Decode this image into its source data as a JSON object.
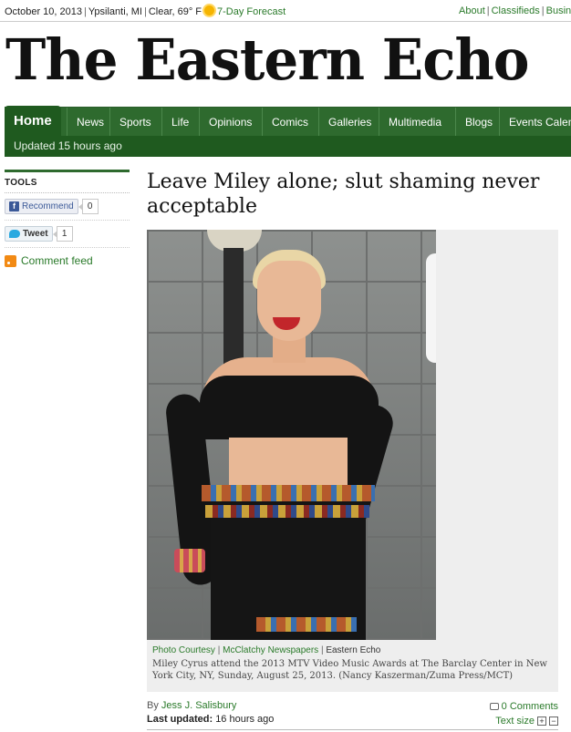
{
  "topbar": {
    "date": "October 10, 2013",
    "location": "Ypsilanti, MI",
    "weather": "Clear, 69° F",
    "forecast_link": "7-Day Forecast",
    "right_links": [
      "About",
      "Classifieds",
      "Busin"
    ]
  },
  "masthead": {
    "title": "The Eastern Echo"
  },
  "nav": {
    "items": [
      "Home",
      "News",
      "Sports",
      "Life",
      "Opinions",
      "Comics",
      "Galleries",
      "Multimedia",
      "Blogs",
      "Events Calen"
    ],
    "updated": "Updated 15 hours ago"
  },
  "tools": {
    "title": "TOOLS",
    "recommend_label": "Recommend",
    "recommend_count": "0",
    "tweet_label": "Tweet",
    "tweet_count": "1",
    "comment_feed": "Comment feed"
  },
  "article": {
    "headline": "Leave Miley alone; slut shaming never acceptable",
    "photo_credit_label": "Photo Courtesy",
    "photo_credit_source": "McClatchy Newspapers",
    "photo_credit_outlet": "Eastern Echo",
    "caption": "Miley Cyrus attend the 2013 MTV Video Music Awards at The Barclay Center in New York City, NY, Sunday, August 25, 2013. (Nancy Kaszerman/Zuma Press/MCT)",
    "by_prefix": "By",
    "author": "Jess J. Salisbury",
    "last_updated_label": "Last updated:",
    "last_updated_value": "16 hours ago",
    "comments": "0 Comments",
    "text_size_label": "Text size"
  }
}
